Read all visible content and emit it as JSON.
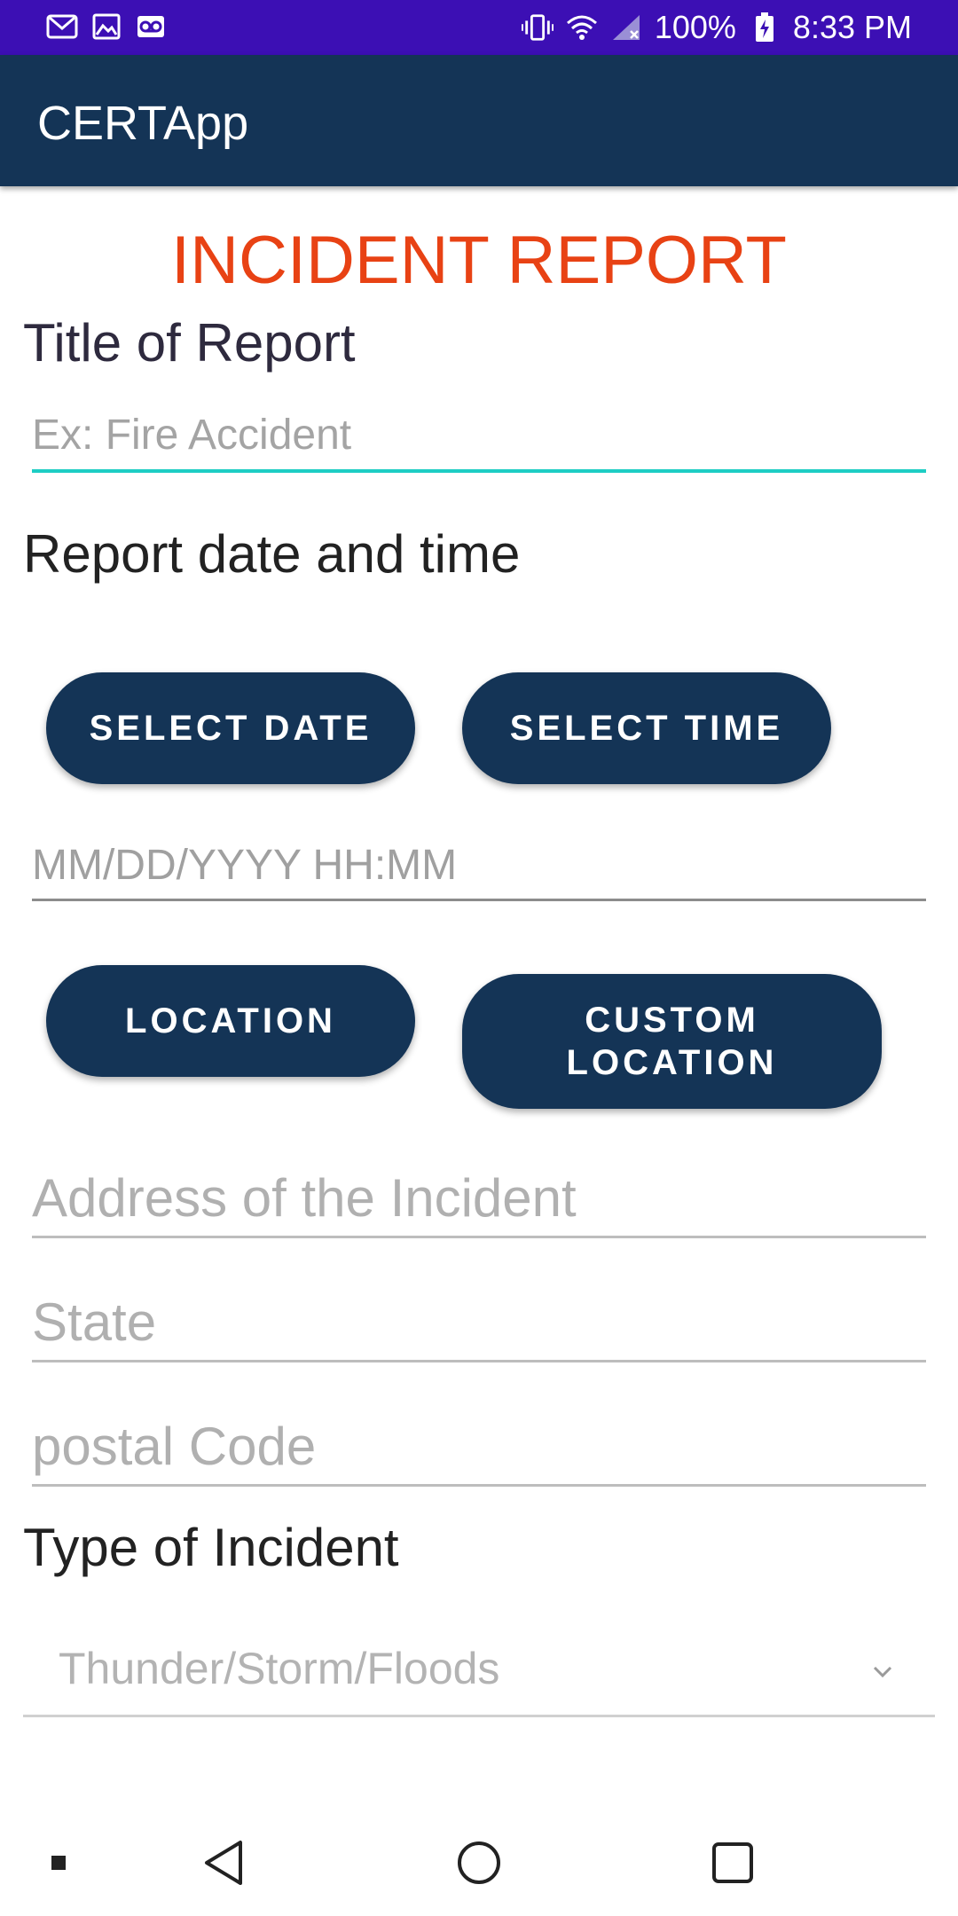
{
  "status_bar": {
    "battery_text": "100%",
    "time": "8:33 PM",
    "left_icons": [
      "gmail-icon",
      "image-icon",
      "voicemail-icon"
    ],
    "right_icons": [
      "vibrate-icon",
      "wifi-icon",
      "signal-icon",
      "battery-charging-icon"
    ]
  },
  "app_bar": {
    "title": "CERTApp"
  },
  "form": {
    "heading": "INCIDENT REPORT",
    "title_label": "Title of Report",
    "title_placeholder": "Ex: Fire Accident",
    "datetime_label": "Report date and time",
    "select_date_label": "SELECT DATE",
    "select_time_label": "SELECT TIME",
    "datetime_placeholder": "MM/DD/YYYY HH:MM",
    "location_label": "LOCATION",
    "custom_location_label": "CUSTOM\nLOCATION",
    "address_placeholder": "Address of the Incident",
    "state_placeholder": "State",
    "postal_placeholder": "postal Code",
    "type_label": "Type of Incident",
    "type_selected": "Thunder/Storm/Floods"
  },
  "nav_bar": {
    "icons": [
      "square-dot-icon",
      "back-icon",
      "home-icon",
      "recents-icon"
    ]
  },
  "colors": {
    "status_bar": "#3c0fb4",
    "app_bar": "#143456",
    "heading": "#e84214",
    "accent_line": "#1dcdc4",
    "button": "#143456"
  }
}
